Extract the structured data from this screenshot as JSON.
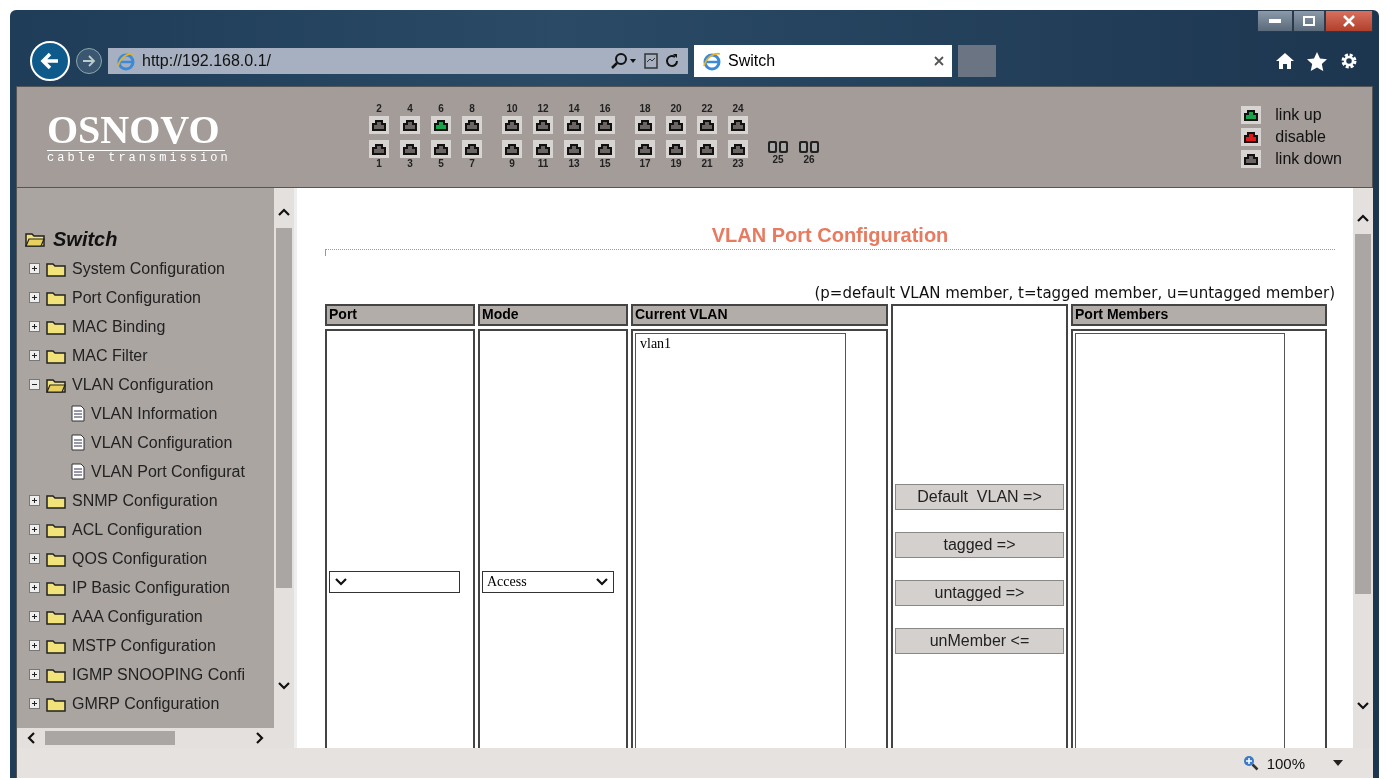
{
  "browser": {
    "url": "http://192.168.0.1/",
    "tab": {
      "title": "Switch"
    },
    "zoom": "100%"
  },
  "banner": {
    "logo": "OSNOVO",
    "tagline": "cable transmission",
    "port_groups": [
      [
        {
          "top": {
            "label": "2",
            "color": "#6a6462"
          },
          "bottom": {
            "label": "1",
            "color": "#6a6462"
          }
        },
        {
          "top": {
            "label": "4",
            "color": "#6a6462"
          },
          "bottom": {
            "label": "3",
            "color": "#6a6462"
          }
        },
        {
          "top": {
            "label": "6",
            "color": "#1aa34a"
          },
          "bottom": {
            "label": "5",
            "color": "#6a6462"
          }
        },
        {
          "top": {
            "label": "8",
            "color": "#6a6462"
          },
          "bottom": {
            "label": "7",
            "color": "#6a6462"
          }
        }
      ],
      [
        {
          "top": {
            "label": "10",
            "color": "#6a6462"
          },
          "bottom": {
            "label": "9",
            "color": "#6a6462"
          }
        },
        {
          "top": {
            "label": "12",
            "color": "#6a6462"
          },
          "bottom": {
            "label": "11",
            "color": "#6a6462"
          }
        },
        {
          "top": {
            "label": "14",
            "color": "#6a6462"
          },
          "bottom": {
            "label": "13",
            "color": "#6a6462"
          }
        },
        {
          "top": {
            "label": "16",
            "color": "#6a6462"
          },
          "bottom": {
            "label": "15",
            "color": "#6a6462"
          }
        }
      ],
      [
        {
          "top": {
            "label": "18",
            "color": "#6a6462"
          },
          "bottom": {
            "label": "17",
            "color": "#6a6462"
          }
        },
        {
          "top": {
            "label": "20",
            "color": "#6a6462"
          },
          "bottom": {
            "label": "19",
            "color": "#6a6462"
          }
        },
        {
          "top": {
            "label": "22",
            "color": "#6a6462"
          },
          "bottom": {
            "label": "21",
            "color": "#6a6462"
          }
        },
        {
          "top": {
            "label": "24",
            "color": "#6a6462"
          },
          "bottom": {
            "label": "23",
            "color": "#6a6462"
          }
        }
      ],
      [
        {
          "bottom": {
            "label": "25",
            "kind": "fiber"
          }
        },
        {
          "bottom": {
            "label": "26",
            "kind": "fiber"
          }
        }
      ]
    ],
    "legend": [
      {
        "label": "link up",
        "color": "#1aa34a"
      },
      {
        "label": "disable",
        "color": "#e01818"
      },
      {
        "label": "link down",
        "color": "#6a6462"
      }
    ]
  },
  "sidebar": {
    "root": "Switch",
    "items": [
      {
        "label": "System Configuration",
        "expanded": false
      },
      {
        "label": "Port Configuration",
        "expanded": false
      },
      {
        "label": "MAC Binding",
        "expanded": false
      },
      {
        "label": "MAC Filter",
        "expanded": false
      },
      {
        "label": "VLAN Configuration",
        "expanded": true,
        "children": [
          {
            "label": "VLAN Information"
          },
          {
            "label": "VLAN Configuration"
          },
          {
            "label": "VLAN Port Configurat"
          }
        ]
      },
      {
        "label": "SNMP Configuration",
        "expanded": false
      },
      {
        "label": "ACL Configuration",
        "expanded": false
      },
      {
        "label": "QOS Configuration",
        "expanded": false
      },
      {
        "label": "IP Basic Configuration",
        "expanded": false
      },
      {
        "label": "AAA Configuration",
        "expanded": false
      },
      {
        "label": "MSTP Configuration",
        "expanded": false
      },
      {
        "label": "IGMP SNOOPING Confi",
        "expanded": false
      },
      {
        "label": "GMRP Configuration",
        "expanded": false
      }
    ]
  },
  "main": {
    "title": "VLAN Port Configuration",
    "note": "(p=default VLAN member, t=tagged member, u=untagged member)",
    "columns": [
      {
        "kind": "select",
        "header": "Port"
      },
      {
        "kind": "select",
        "header": "Mode",
        "value": "Access"
      },
      {
        "kind": "list",
        "header": "Current VLAN",
        "items": [
          "vlan1"
        ]
      },
      {
        "kind": "buttons",
        "buttons": [
          "Default  VLAN =>",
          "tagged =>",
          "untagged =>",
          "unMember <="
        ]
      },
      {
        "kind": "list",
        "header": "Port Members"
      }
    ]
  }
}
